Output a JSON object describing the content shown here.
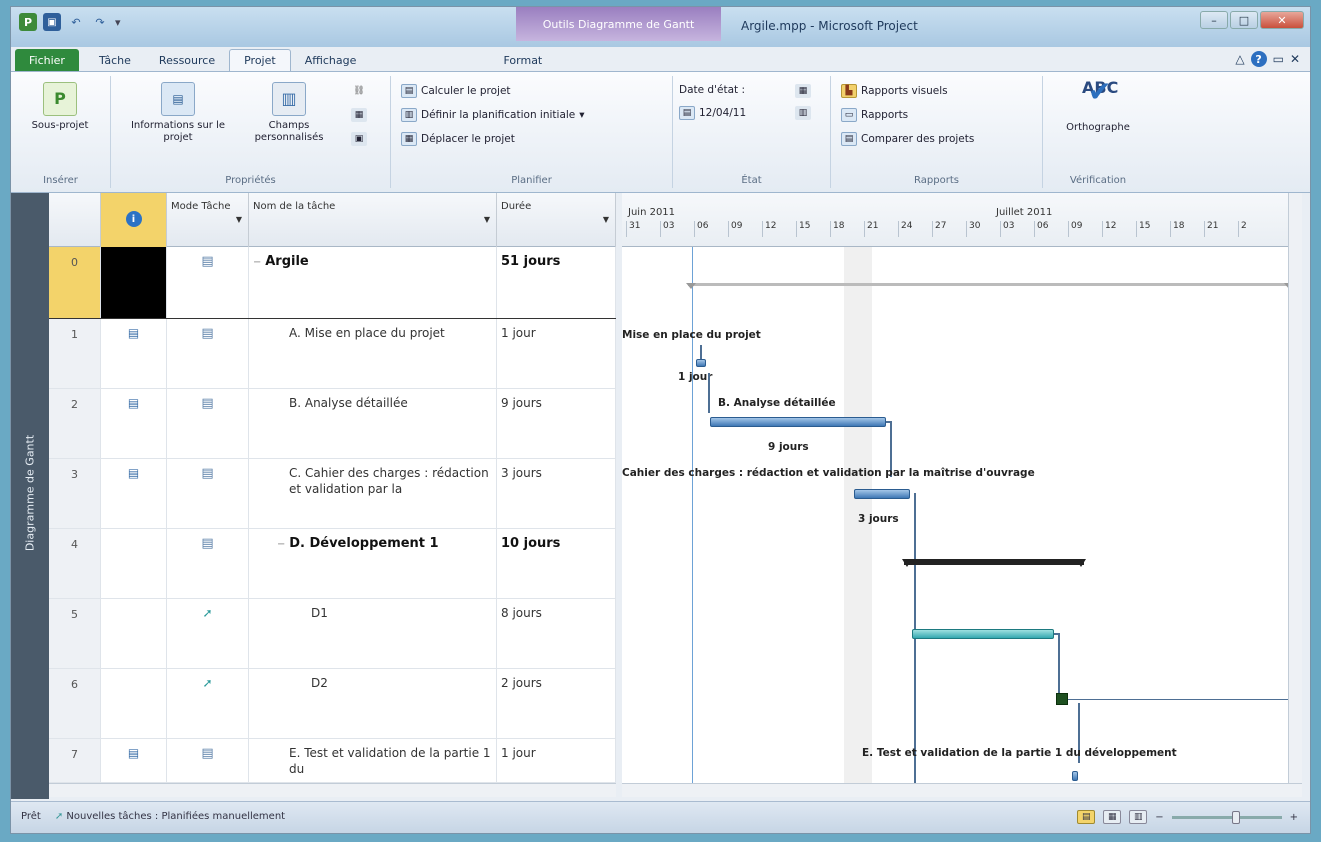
{
  "window": {
    "title": "Argile.mpp - Microsoft Project",
    "context_tab_title": "Outils Diagramme de Gantt"
  },
  "tabs": [
    {
      "label": "Fichier"
    },
    {
      "label": "Tâche"
    },
    {
      "label": "Ressource"
    },
    {
      "label": "Projet"
    },
    {
      "label": "Affichage"
    },
    {
      "label": "Format"
    }
  ],
  "ribbon": {
    "insert": {
      "sous_projet": "Sous-projet",
      "label": "Insérer"
    },
    "proprietes": {
      "info": "Informations sur le projet",
      "champs": "Champs personnalisés",
      "label": "Propriétés"
    },
    "planifier": {
      "calculer": "Calculer le projet",
      "definir": "Définir la planification initiale",
      "deplacer": "Déplacer le projet",
      "label": "Planifier"
    },
    "etat": {
      "date_etat": "Date d'état :",
      "date_value": "12/04/11",
      "label": "État"
    },
    "rapports": {
      "visuels": "Rapports visuels",
      "rapports": "Rapports",
      "comparer": "Comparer des projets",
      "label": "Rapports"
    },
    "verification": {
      "ortho": "Orthographe",
      "label": "Vérification",
      "abc": "ABC"
    }
  },
  "view_label": "Diagramme de Gantt",
  "grid": {
    "headers": {
      "mode": "Mode Tâche",
      "name": "Nom de la tâche",
      "duration": "Durée"
    },
    "rows": [
      {
        "id": "0",
        "name": "Argile",
        "duration": "51 jours",
        "bold": true
      },
      {
        "id": "1",
        "name": "A. Mise en place du projet",
        "duration": "1 jour"
      },
      {
        "id": "2",
        "name": "B. Analyse détaillée",
        "duration": "9 jours"
      },
      {
        "id": "3",
        "name": "C. Cahier des charges : rédaction et validation par la",
        "duration": "3 jours"
      },
      {
        "id": "4",
        "name": "D. Développement 1",
        "duration": "10 jours",
        "bold": true
      },
      {
        "id": "5",
        "name": "D1",
        "duration": "8 jours"
      },
      {
        "id": "6",
        "name": "D2",
        "duration": "2 jours"
      },
      {
        "id": "7",
        "name": "E. Test et validation de la partie 1 du",
        "duration": "1 jour"
      }
    ]
  },
  "gantt": {
    "months": [
      "Juin 2011",
      "Juillet 2011"
    ],
    "days": [
      "31",
      "03",
      "06",
      "09",
      "12",
      "15",
      "18",
      "21",
      "24",
      "27",
      "30",
      "03",
      "06",
      "09",
      "12",
      "15",
      "18",
      "21",
      "2"
    ],
    "labels": {
      "a": "Mise en place du projet",
      "a_dur": "1 jour",
      "b": "B. Analyse détaillée",
      "b_dur": "9 jours",
      "c": "Cahier des charges : rédaction et validation par la maîtrise d'ouvrage",
      "c_dur": "3 jours",
      "e": "E. Test et validation de la partie 1 du développement"
    }
  },
  "status": {
    "ready": "Prêt",
    "new_tasks": "Nouvelles tâches : Planifiées manuellement"
  }
}
